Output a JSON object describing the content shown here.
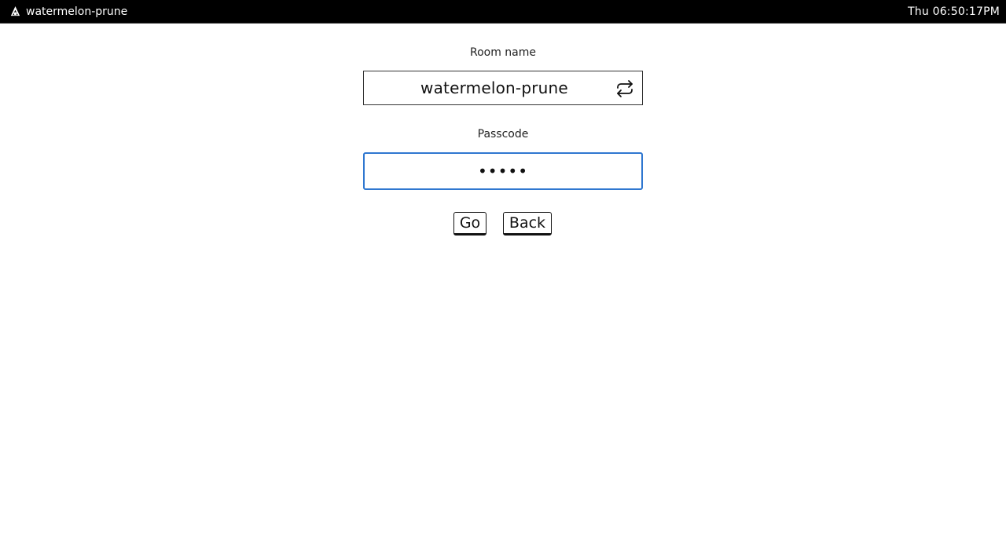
{
  "topbar": {
    "app_name": "watermelon-prune",
    "logo_icon": "tree-icon",
    "clock": "Thu 06:50:17PM"
  },
  "form": {
    "room_label": "Room name",
    "room_value": "watermelon-prune",
    "regenerate_icon": "repeat-icon",
    "passcode_label": "Passcode",
    "passcode_value": "•••••",
    "go_label": "Go",
    "back_label": "Back"
  },
  "colors": {
    "topbar_bg": "#000000",
    "focus_border": "#2f77d0"
  }
}
